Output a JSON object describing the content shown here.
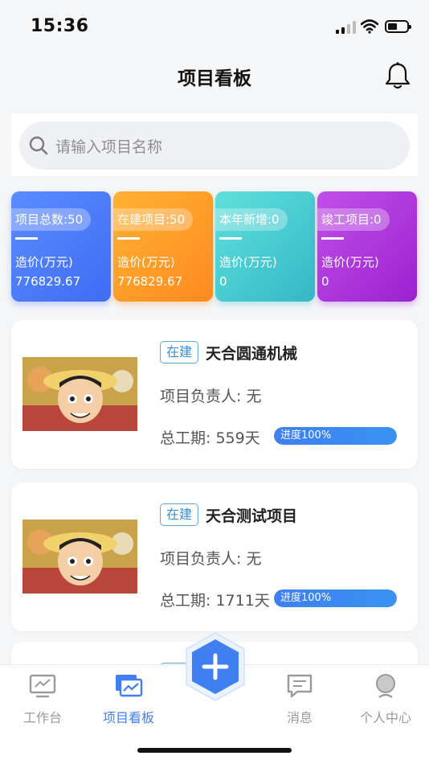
{
  "status_bar": {
    "time": "15:36"
  },
  "header": {
    "title": "项目看板"
  },
  "search": {
    "placeholder": "请输入项目名称"
  },
  "stats": [
    {
      "label": "项目总数:50",
      "cost_label": "造价(万元)",
      "cost_value": "776829.67"
    },
    {
      "label": "在建项目:50",
      "cost_label": "造价(万元)",
      "cost_value": "776829.67"
    },
    {
      "label": "本年新增:0",
      "cost_label": "造价(万元)",
      "cost_value": "0"
    },
    {
      "label": "竣工项目:0",
      "cost_label": "造价(万元)",
      "cost_value": "0"
    }
  ],
  "projects": [
    {
      "status": "在建",
      "name": "天合圆通机械",
      "owner": "项目负责人: 无",
      "duration": "总工期: 559天",
      "progress_text": "进度100%",
      "progress": 100
    },
    {
      "status": "在建",
      "name": "天合测试项目",
      "owner": "项目负责人: 无",
      "duration": "总工期: 1711天",
      "progress_text": "进度100%",
      "progress": 100
    },
    {
      "status": "在建"
    }
  ],
  "tabs": [
    {
      "label": "工作台",
      "icon": "monitor-icon"
    },
    {
      "label": "项目看板",
      "icon": "board-icon",
      "active": true
    },
    {
      "label": "消息",
      "icon": "message-icon"
    },
    {
      "label": "个人中心",
      "icon": "user-icon"
    }
  ],
  "colors": {
    "accent": "#3f7ff0",
    "card_blue": "#4a7af8",
    "card_orange": "#ff9a28",
    "card_teal": "#45c8cf",
    "card_purple": "#ad34dc"
  }
}
